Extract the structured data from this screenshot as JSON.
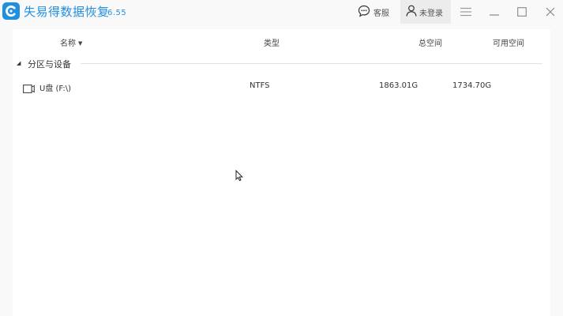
{
  "app": {
    "title": "失易得数据恢复",
    "version": "6.55"
  },
  "titlebar": {
    "service_label": "客服",
    "login_label": "未登录"
  },
  "table": {
    "headers": {
      "name": "名称",
      "type": "类型",
      "total": "总空间",
      "free": "可用空间"
    }
  },
  "groups": [
    {
      "label": "分区与设备",
      "expanded": true,
      "items": [
        {
          "name": "U盘 (F:\\)",
          "type": "NTFS",
          "total": "1863.01G",
          "free": "1734.70G",
          "icon": "usb-drive-icon"
        }
      ]
    }
  ],
  "colors": {
    "accent": "#1f8fe0",
    "background": "#f9f9f9",
    "panel": "#ffffff"
  }
}
